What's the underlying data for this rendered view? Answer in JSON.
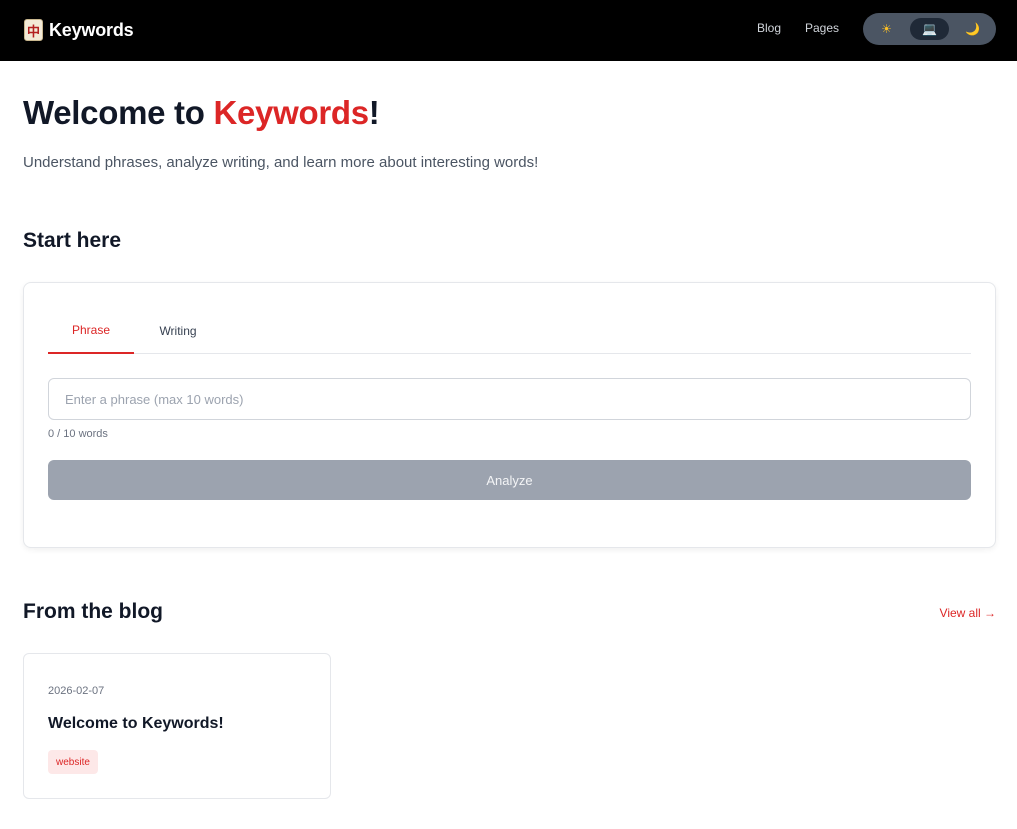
{
  "header": {
    "logo_icon": "mahjong-tile-icon",
    "logo_glyph": "中",
    "brand": "Keywords",
    "nav": [
      {
        "label": "Blog"
      },
      {
        "label": "Pages"
      }
    ],
    "theme_toggle": {
      "options": [
        {
          "icon": "sun-icon",
          "glyph": "☀"
        },
        {
          "icon": "laptop-icon",
          "glyph": "💻"
        },
        {
          "icon": "moon-icon",
          "glyph": "🌙"
        }
      ],
      "selected": "laptop-icon"
    }
  },
  "hero": {
    "title_prefix": "Welcome to ",
    "title_accent": "Keywords",
    "title_suffix": "!",
    "subtitle": "Understand phrases, analyze writing, and learn more about interesting words!"
  },
  "start": {
    "heading": "Start here",
    "tabs": [
      {
        "label": "Phrase",
        "active": true
      },
      {
        "label": "Writing",
        "active": false
      }
    ],
    "input": {
      "placeholder": "Enter a phrase (max 10 words)",
      "value": ""
    },
    "word_count": "0 / 10 words",
    "button_label": "Analyze"
  },
  "blog": {
    "heading": "From the blog",
    "view_all": "View all →",
    "posts": [
      {
        "date": "2026-02-07",
        "title": "Welcome to Keywords!",
        "tag": "website"
      }
    ]
  },
  "colors": {
    "accent": "#dc2626",
    "header_bg": "#000000",
    "button_disabled": "#9ca3af"
  }
}
